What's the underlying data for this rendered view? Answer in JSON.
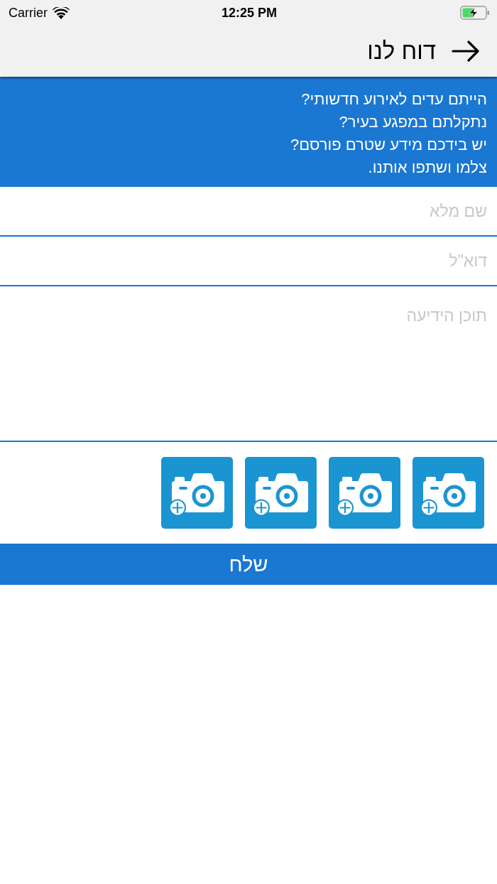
{
  "status_bar": {
    "carrier": "Carrier",
    "time": "12:25 PM",
    "battery_charging": true
  },
  "nav_bar": {
    "title": "דוח לנו"
  },
  "intro": {
    "lines": [
      "הייתם עדים לאירוע חדשותי?",
      "נתקלתם במפגע בעיר?",
      "יש בידכם מידע שטרם פורסם?",
      "צלמו ושתפו אותנו."
    ]
  },
  "form": {
    "fields": [
      {
        "kind": "text",
        "placeholder": "שם מלא"
      },
      {
        "kind": "email",
        "placeholder": "דוא\"ל"
      },
      {
        "kind": "multiline",
        "placeholder": "תוכן הידיעה"
      }
    ]
  },
  "photo_slots": [
    {
      "kind": "add"
    },
    {
      "kind": "add"
    },
    {
      "kind": "add"
    },
    {
      "kind": "add"
    }
  ],
  "submit_button": {
    "label": "שלח"
  }
}
